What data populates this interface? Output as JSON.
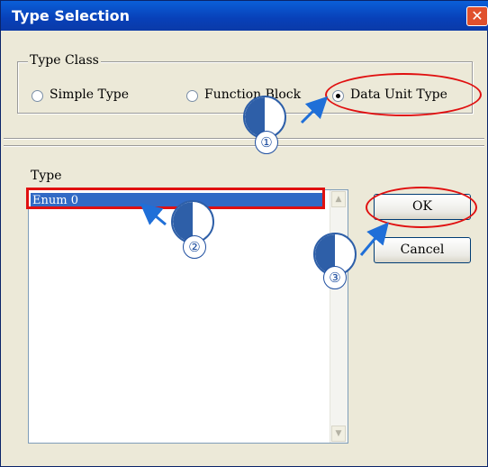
{
  "window": {
    "title": "Type Selection",
    "close_glyph": "✕"
  },
  "type_class": {
    "label": "Type Class",
    "options": [
      {
        "label": "Simple Type",
        "selected": false
      },
      {
        "label": "Function Block",
        "selected": false
      },
      {
        "label": "Data Unit Type",
        "selected": true
      }
    ]
  },
  "type": {
    "label": "Type",
    "items": [
      "Enum 0"
    ],
    "selected_index": 0
  },
  "buttons": {
    "ok": "OK",
    "cancel": "Cancel"
  },
  "callouts": [
    "①",
    "②",
    "③"
  ],
  "colors": {
    "title_bar": "#0a5fd8",
    "selection": "#316ac5",
    "annotation_red": "#e01010",
    "annotation_blue": "#1f4fa0"
  }
}
